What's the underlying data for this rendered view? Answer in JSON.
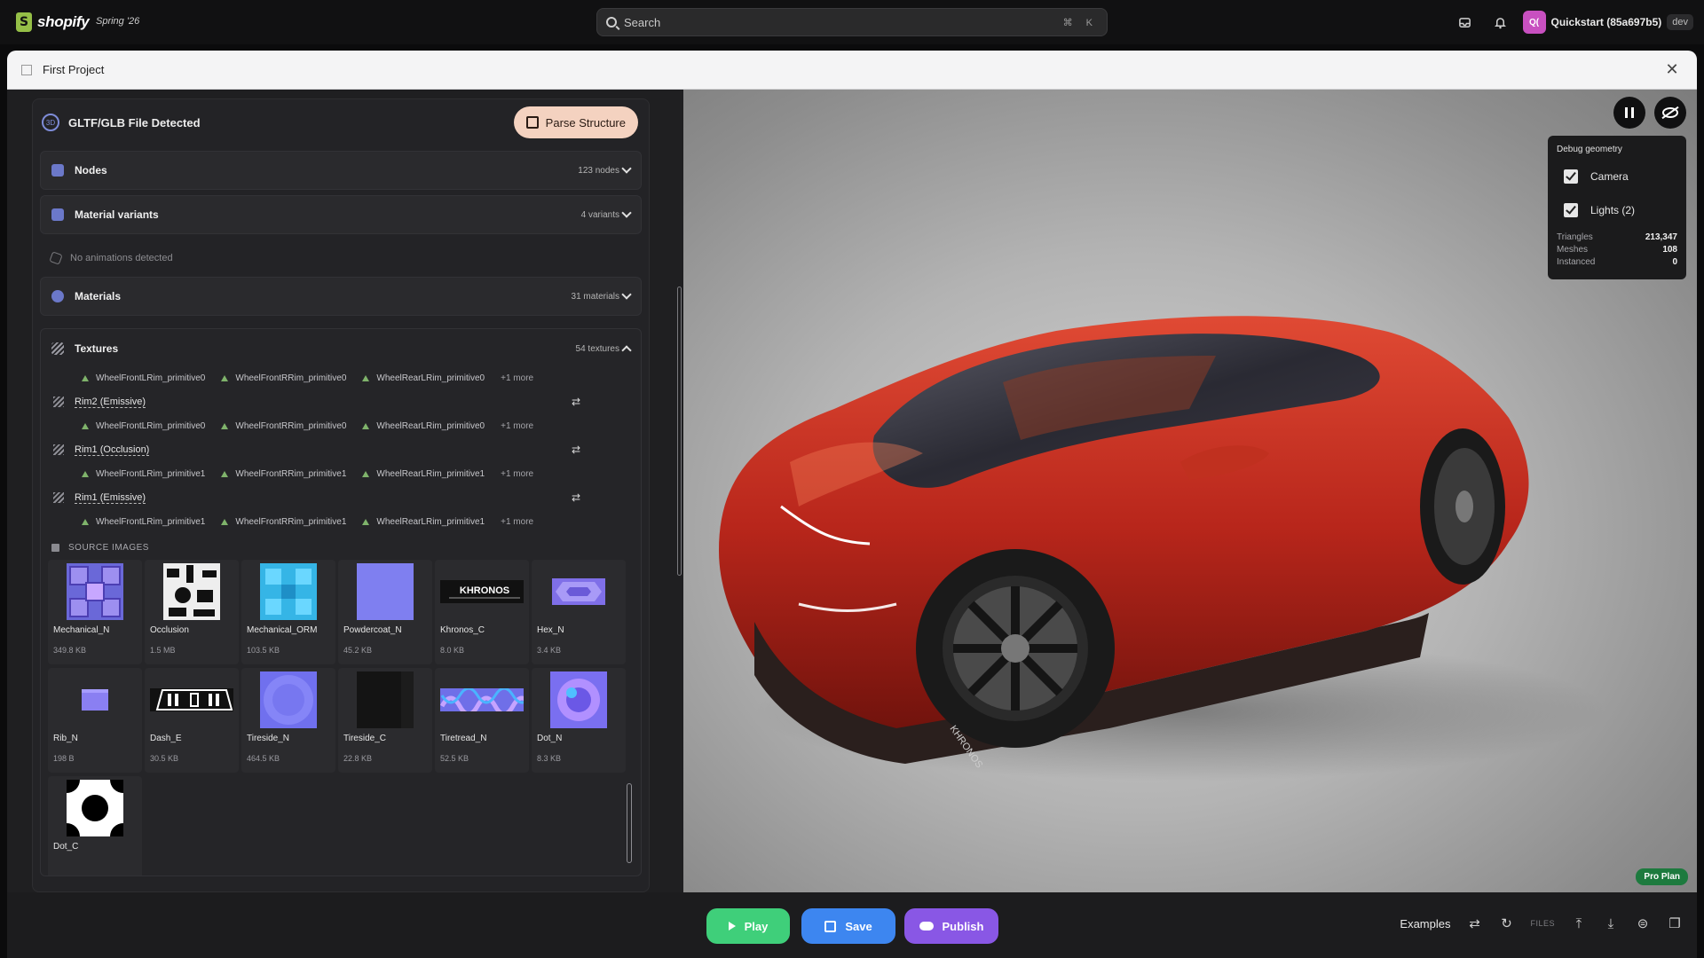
{
  "topbar": {
    "brand": "shopify",
    "edition": "Spring '26",
    "search_placeholder": "Search",
    "search_shortcut": "⌘ K",
    "store_initials": "Q(",
    "store_name": "Quickstart (85a697b5)",
    "env": "dev"
  },
  "modal": {
    "title": "First Project"
  },
  "gltf": {
    "title": "GLTF/GLB File Detected",
    "parse_label": "Parse Structure",
    "sections": [
      {
        "title": "Nodes",
        "count": "123 nodes"
      },
      {
        "title": "Material variants",
        "count": "4 variants"
      }
    ],
    "no_animations": "No animations detected",
    "materials": {
      "title": "Materials",
      "count": "31 materials"
    },
    "textures": {
      "title": "Textures",
      "count": "54 textures",
      "first_chips": [
        "WheelFrontLRim_primitive0",
        "WheelFrontRRim_primitive0",
        "WheelRearLRim_primitive0",
        "+1 more"
      ],
      "items": [
        {
          "name": "Rim2 (Emissive)",
          "chips": [
            "WheelFrontLRim_primitive0",
            "WheelFrontRRim_primitive0",
            "WheelRearLRim_primitive0",
            "+1 more"
          ]
        },
        {
          "name": "Rim1 (Occlusion)",
          "chips": [
            "WheelFrontLRim_primitive1",
            "WheelFrontRRim_primitive1",
            "WheelRearLRim_primitive1",
            "+1 more"
          ]
        },
        {
          "name": "Rim1 (Emissive)",
          "chips": [
            "WheelFrontLRim_primitive1",
            "WheelFrontRRim_primitive1",
            "WheelRearLRim_primitive1",
            "+1 more"
          ]
        }
      ],
      "source_images_label": "SOURCE IMAGES",
      "source_images": [
        {
          "name": "Mechanical_N",
          "size": "349.8 KB"
        },
        {
          "name": "Occlusion",
          "size": "1.5 MB"
        },
        {
          "name": "Mechanical_ORM",
          "size": "103.5 KB"
        },
        {
          "name": "Powdercoat_N",
          "size": "45.2 KB"
        },
        {
          "name": "Khronos_C",
          "size": "8.0 KB"
        },
        {
          "name": "Hex_N",
          "size": "3.4 KB"
        },
        {
          "name": "Rib_N",
          "size": "198 B"
        },
        {
          "name": "Dash_E",
          "size": "30.5 KB"
        },
        {
          "name": "Tireside_N",
          "size": "464.5 KB"
        },
        {
          "name": "Tireside_C",
          "size": "22.8 KB"
        },
        {
          "name": "Tiretread_N",
          "size": "52.5 KB"
        },
        {
          "name": "Dot_N",
          "size": "8.3 KB"
        },
        {
          "name": "Dot_C",
          "size": ""
        }
      ],
      "khronos_logo_text": "KHRONOS"
    }
  },
  "viewport": {
    "debug_title": "Debug geometry",
    "toggles": [
      {
        "label": "Camera",
        "checked": true
      },
      {
        "label": "Lights (2)",
        "checked": true
      }
    ],
    "stats": [
      {
        "label": "Triangles",
        "value": "213,347"
      },
      {
        "label": "Meshes",
        "value": "108"
      },
      {
        "label": "Instanced",
        "value": "0"
      }
    ],
    "plan": "Pro Plan",
    "tire_text": "KHRONOS"
  },
  "bottom": {
    "play": "Play",
    "save": "Save",
    "publish": "Publish",
    "examples": "Examples",
    "files": "FILES"
  },
  "colors": {
    "play": "#3fcf7a",
    "save": "#3d86f0",
    "publish": "#8957e5",
    "parse": "#f4d2c0",
    "car_body": "#b8261b",
    "pro_plan": "#1d7a3e"
  }
}
